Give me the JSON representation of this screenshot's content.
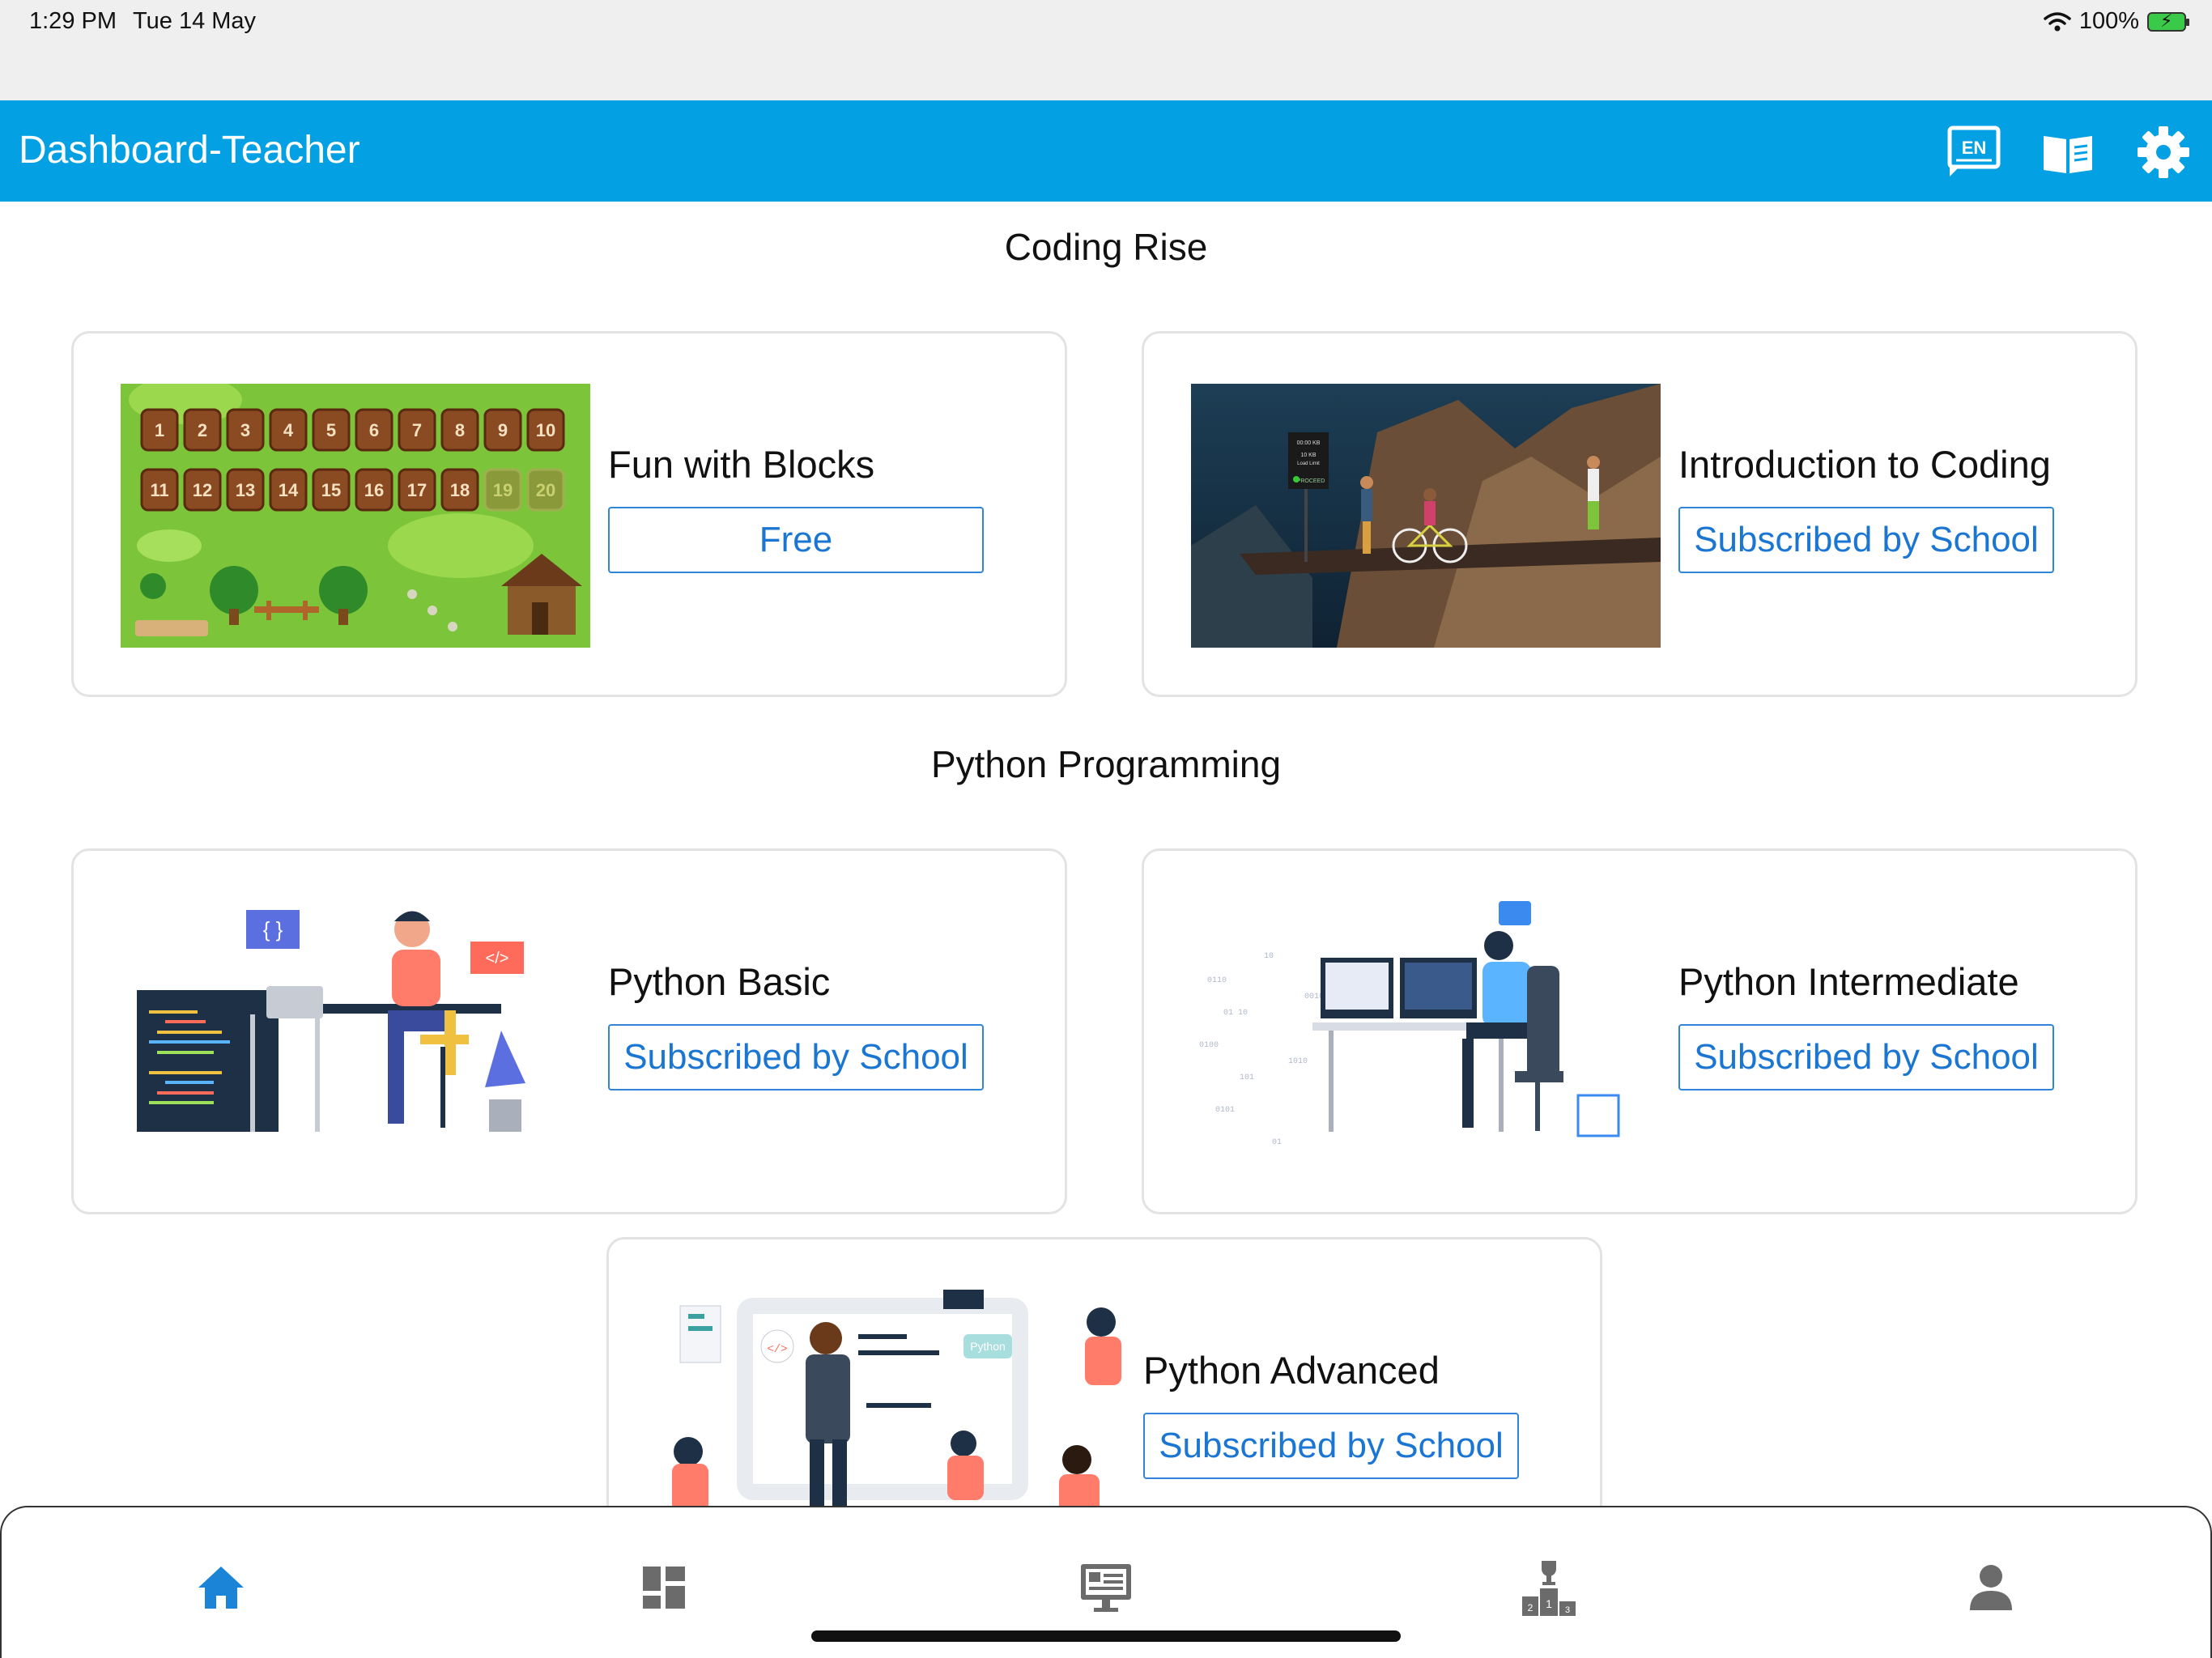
{
  "status_bar": {
    "time": "1:29 PM",
    "date": "Tue 14 May",
    "battery": "100%",
    "icons": [
      "wifi-icon",
      "battery-charging-icon"
    ]
  },
  "app_bar": {
    "title": "Dashboard-Teacher",
    "background_color": "#03a0e3",
    "actions": [
      {
        "name": "language-icon",
        "text": "EN"
      },
      {
        "name": "book-icon"
      },
      {
        "name": "settings-gear-icon"
      }
    ]
  },
  "sections": [
    {
      "title": "Coding Rise",
      "courses": [
        {
          "title": "Fun with Blocks",
          "button": "Free",
          "art": "numbered-blocks-garden-illustration",
          "level_numbers": [
            "1",
            "2",
            "3",
            "4",
            "5",
            "6",
            "7",
            "8",
            "9",
            "10",
            "11",
            "12",
            "13",
            "14",
            "15",
            "16",
            "17",
            "18",
            "19",
            "20"
          ]
        },
        {
          "title": "Introduction to Coding",
          "button": "Subscribed by School",
          "art": "cliff-path-cyclists-illustration",
          "sign": [
            "00:00 KB",
            "10 KB",
            "Load Limit",
            "PROCEED"
          ]
        }
      ]
    },
    {
      "title": "Python Programming",
      "courses": [
        {
          "title": "Python Basic",
          "button": "Subscribed by School",
          "art": "person-coding-at-desk-illustration",
          "badges": [
            "{ }",
            "</>"
          ]
        },
        {
          "title": "Python Intermediate",
          "button": "Subscribed by School",
          "art": "developer-at-dual-monitors-illustration"
        },
        {
          "title": "Python Advanced",
          "button": "Subscribed by School",
          "art": "team-python-presentation-illustration",
          "label": "Python"
        }
      ]
    }
  ],
  "bottom_nav": [
    {
      "name": "home-icon",
      "active": true
    },
    {
      "name": "dashboard-grid-icon",
      "active": false
    },
    {
      "name": "classroom-screen-icon",
      "active": false
    },
    {
      "name": "leaderboard-podium-icon",
      "active": false
    },
    {
      "name": "profile-icon",
      "active": false
    }
  ],
  "colors": {
    "accent": "#03a0e3",
    "button_text": "#1a76d2",
    "nav_active": "#1b84d6",
    "nav_inactive": "#6b6b6b"
  }
}
